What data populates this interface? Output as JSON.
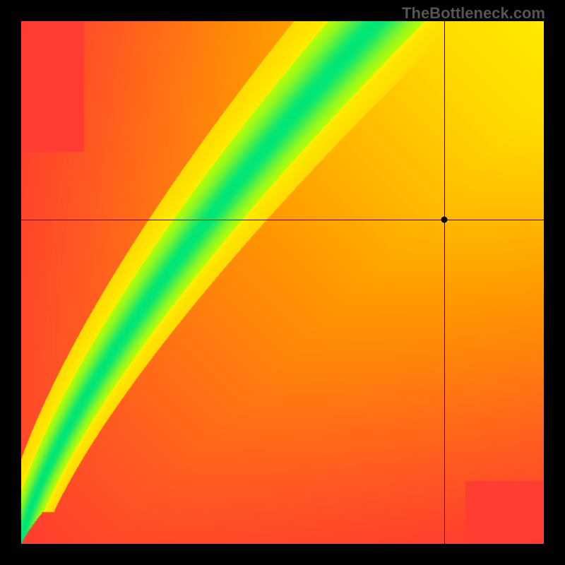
{
  "watermark": "TheBottleneck.com",
  "chart_data": {
    "type": "heatmap",
    "title": "",
    "xlabel": "",
    "ylabel": "",
    "xlim": [
      0,
      1
    ],
    "ylim": [
      0,
      1
    ],
    "grid": false,
    "legend": false,
    "crosshair": {
      "x": 0.81,
      "y": 0.62
    },
    "ridge_start": [
      0.0,
      0.0
    ],
    "ridge_end": [
      0.68,
      1.0
    ],
    "ridge_curve": 1.35,
    "ridge_width_halo": 0.06,
    "ridge_width_core": 0.035,
    "colormap": {
      "stops": [
        {
          "t": 0.0,
          "color": "#ff1744"
        },
        {
          "t": 0.25,
          "color": "#ff5722"
        },
        {
          "t": 0.45,
          "color": "#ff9800"
        },
        {
          "t": 0.62,
          "color": "#ffd600"
        },
        {
          "t": 0.78,
          "color": "#ffff00"
        },
        {
          "t": 0.9,
          "color": "#c6ff00"
        },
        {
          "t": 1.0,
          "color": "#00e676"
        }
      ]
    }
  }
}
